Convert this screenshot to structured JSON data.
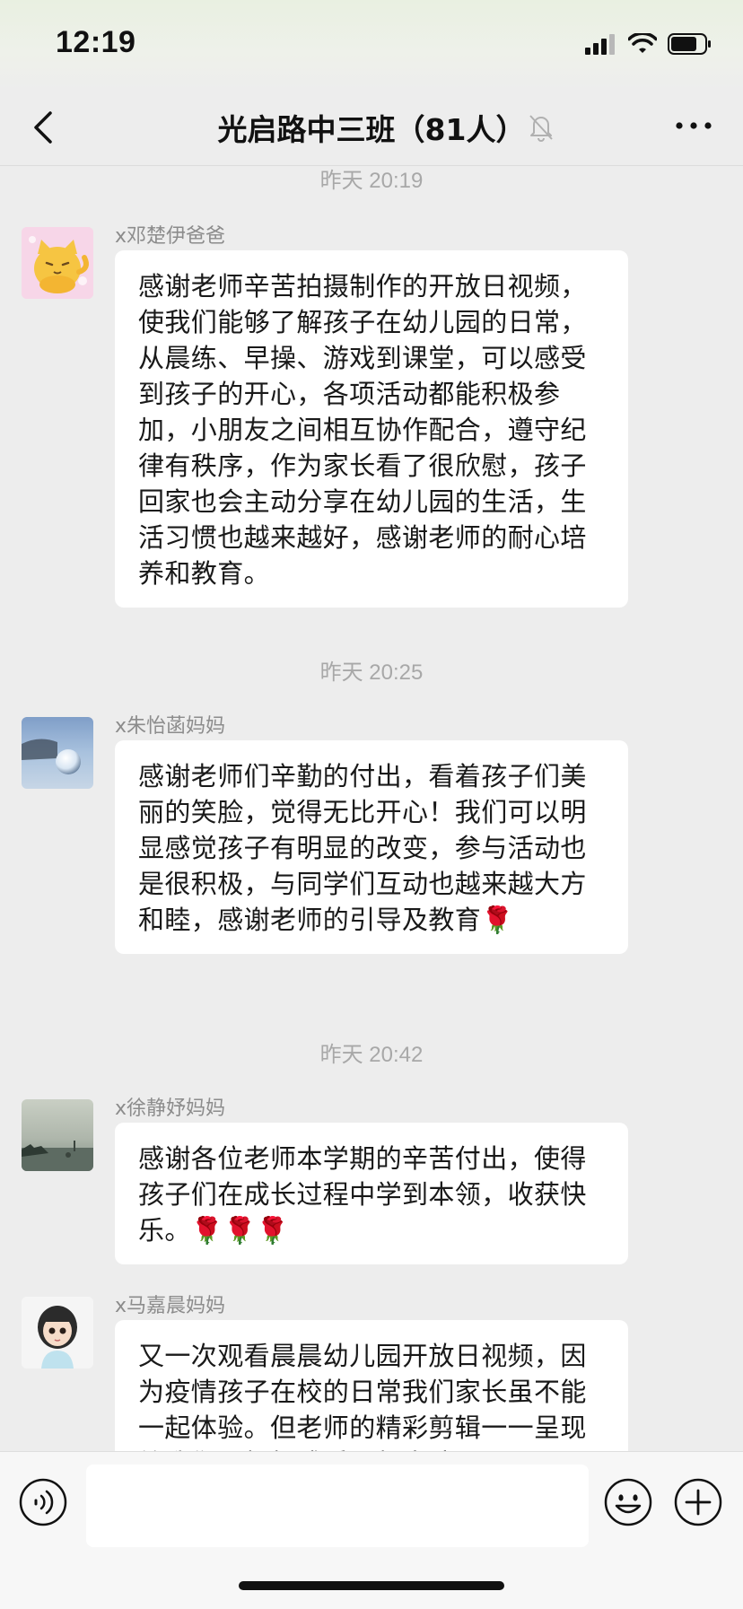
{
  "status_bar": {
    "time": "12:19"
  },
  "header": {
    "title": "光启路中三班（81人）",
    "back_icon": "chevron-left-icon",
    "mute_icon": "bell-off-icon",
    "more_icon": "more-dots-icon"
  },
  "messages": [
    {
      "timestamp": "昨天 20:19",
      "sender": "x邓楚伊爸爸",
      "avatar": "cartoon-cat-avatar",
      "text": "感谢老师辛苦拍摄制作的开放日视频，使我们能够了解孩子在幼儿园的日常，从晨练、早操、游戏到课堂，可以感受到孩子的开心，各项活动都能积极参加，小朋友之间相互协作配合，遵守纪律有秩序，作为家长看了很欣慰，孩子回家也会主动分享在幼儿园的生活，生活习惯也越来越好，感谢老师的耐心培养和教育。"
    },
    {
      "timestamp": "昨天 20:25",
      "sender": "x朱怡菡妈妈",
      "avatar": "glass-ball-avatar",
      "text": "感谢老师们辛勤的付出，看着孩子们美丽的笑脸，觉得无比开心！我们可以明显感觉孩子有明显的改变，参与活动也是很积极，与同学们互动也越来越大方和睦，感谢老师的引导及教育",
      "emoji": "🌹"
    },
    {
      "timestamp": "昨天 20:42",
      "sender": "x徐静妤妈妈",
      "avatar": "seaside-avatar",
      "text": "感谢各位老师本学期的辛苦付出，使得孩子们在成长过程中学到本领，收获快乐。",
      "emoji": "🌹🌹🌹"
    },
    {
      "sender": "x马嘉晨妈妈",
      "avatar": "doll-girl-avatar",
      "text": "又一次观看晨晨幼儿园开放日视频，因为疫情孩子在校的日常我们家长虽不能一起体验。但老师的精彩剪辑一一呈现给我们，粗粗感受一起来陪同"
    }
  ],
  "input_bar": {
    "voice_icon": "voice-icon",
    "emoji_icon": "smiley-icon",
    "plus_icon": "plus-circle-icon",
    "placeholder": ""
  }
}
